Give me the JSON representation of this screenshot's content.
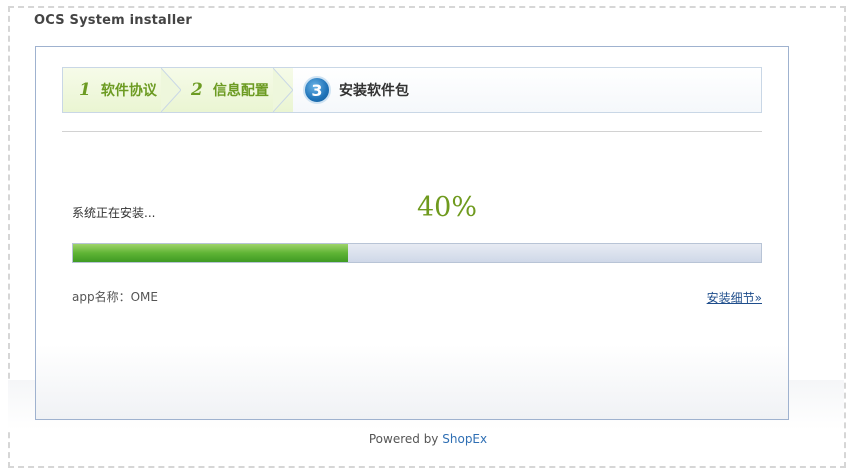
{
  "window": {
    "title": "OCS System installer"
  },
  "steps": [
    {
      "number": "1",
      "label": "软件协议",
      "state": "done"
    },
    {
      "number": "2",
      "label": "信息配置",
      "state": "done"
    },
    {
      "number": "3",
      "label": "安装软件包",
      "state": "current"
    }
  ],
  "install": {
    "status_text": "系统正在安装...",
    "percent_label": "40%",
    "progress": 0.4,
    "app_name_label": "app名称：OME",
    "details_link": "安装细节»"
  },
  "footer": {
    "powered_by": "Powered by",
    "brand": "ShopEx"
  },
  "colors": {
    "accent_green": "#6c9b22",
    "progress_green": "#5fb435",
    "link_blue": "#1f4e8c",
    "step_circle_blue": "#1f73b8"
  }
}
